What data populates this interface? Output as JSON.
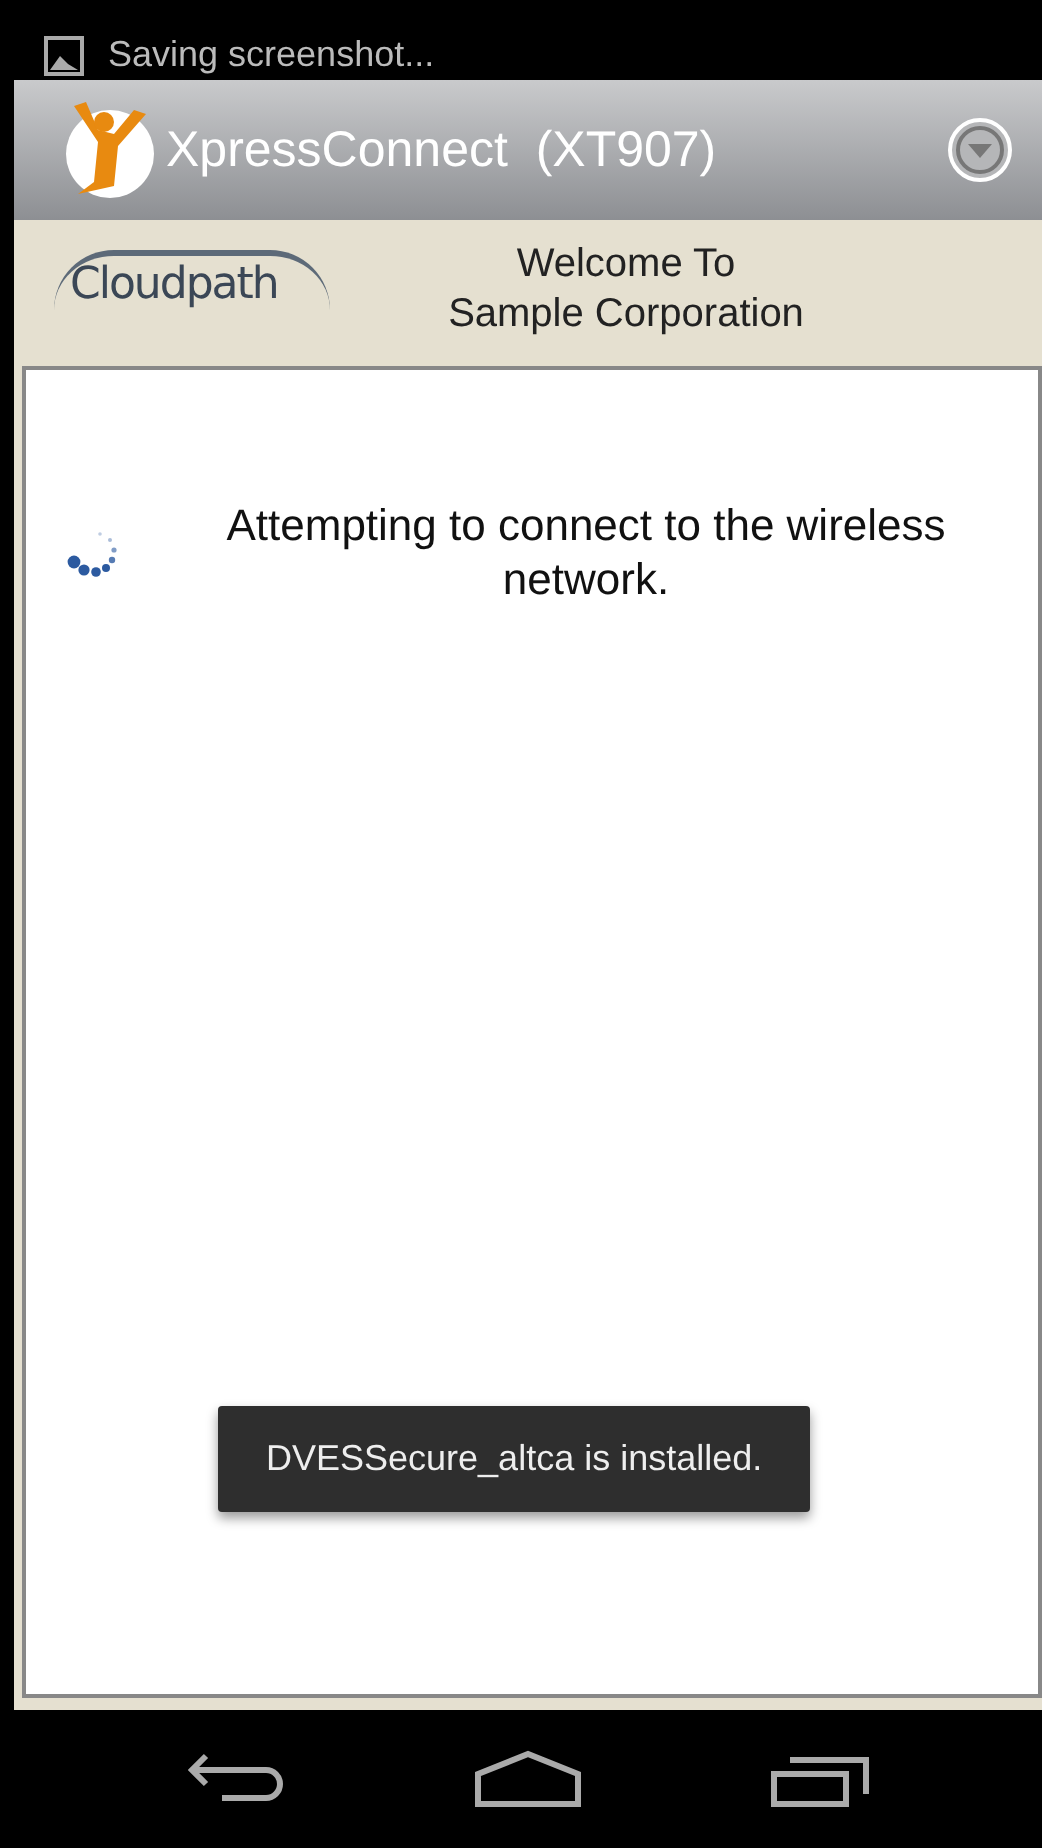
{
  "notification": {
    "text": "Saving screenshot..."
  },
  "app_bar": {
    "title": "XpressConnect  (XT907)"
  },
  "header": {
    "logo": "Cloudpath",
    "welcome": [
      "Welcome To",
      "Sample Corporation"
    ]
  },
  "content": {
    "message": "Attempting to connect to the wireless network."
  },
  "toast": {
    "text": "DVESSecure_altca is installed."
  }
}
